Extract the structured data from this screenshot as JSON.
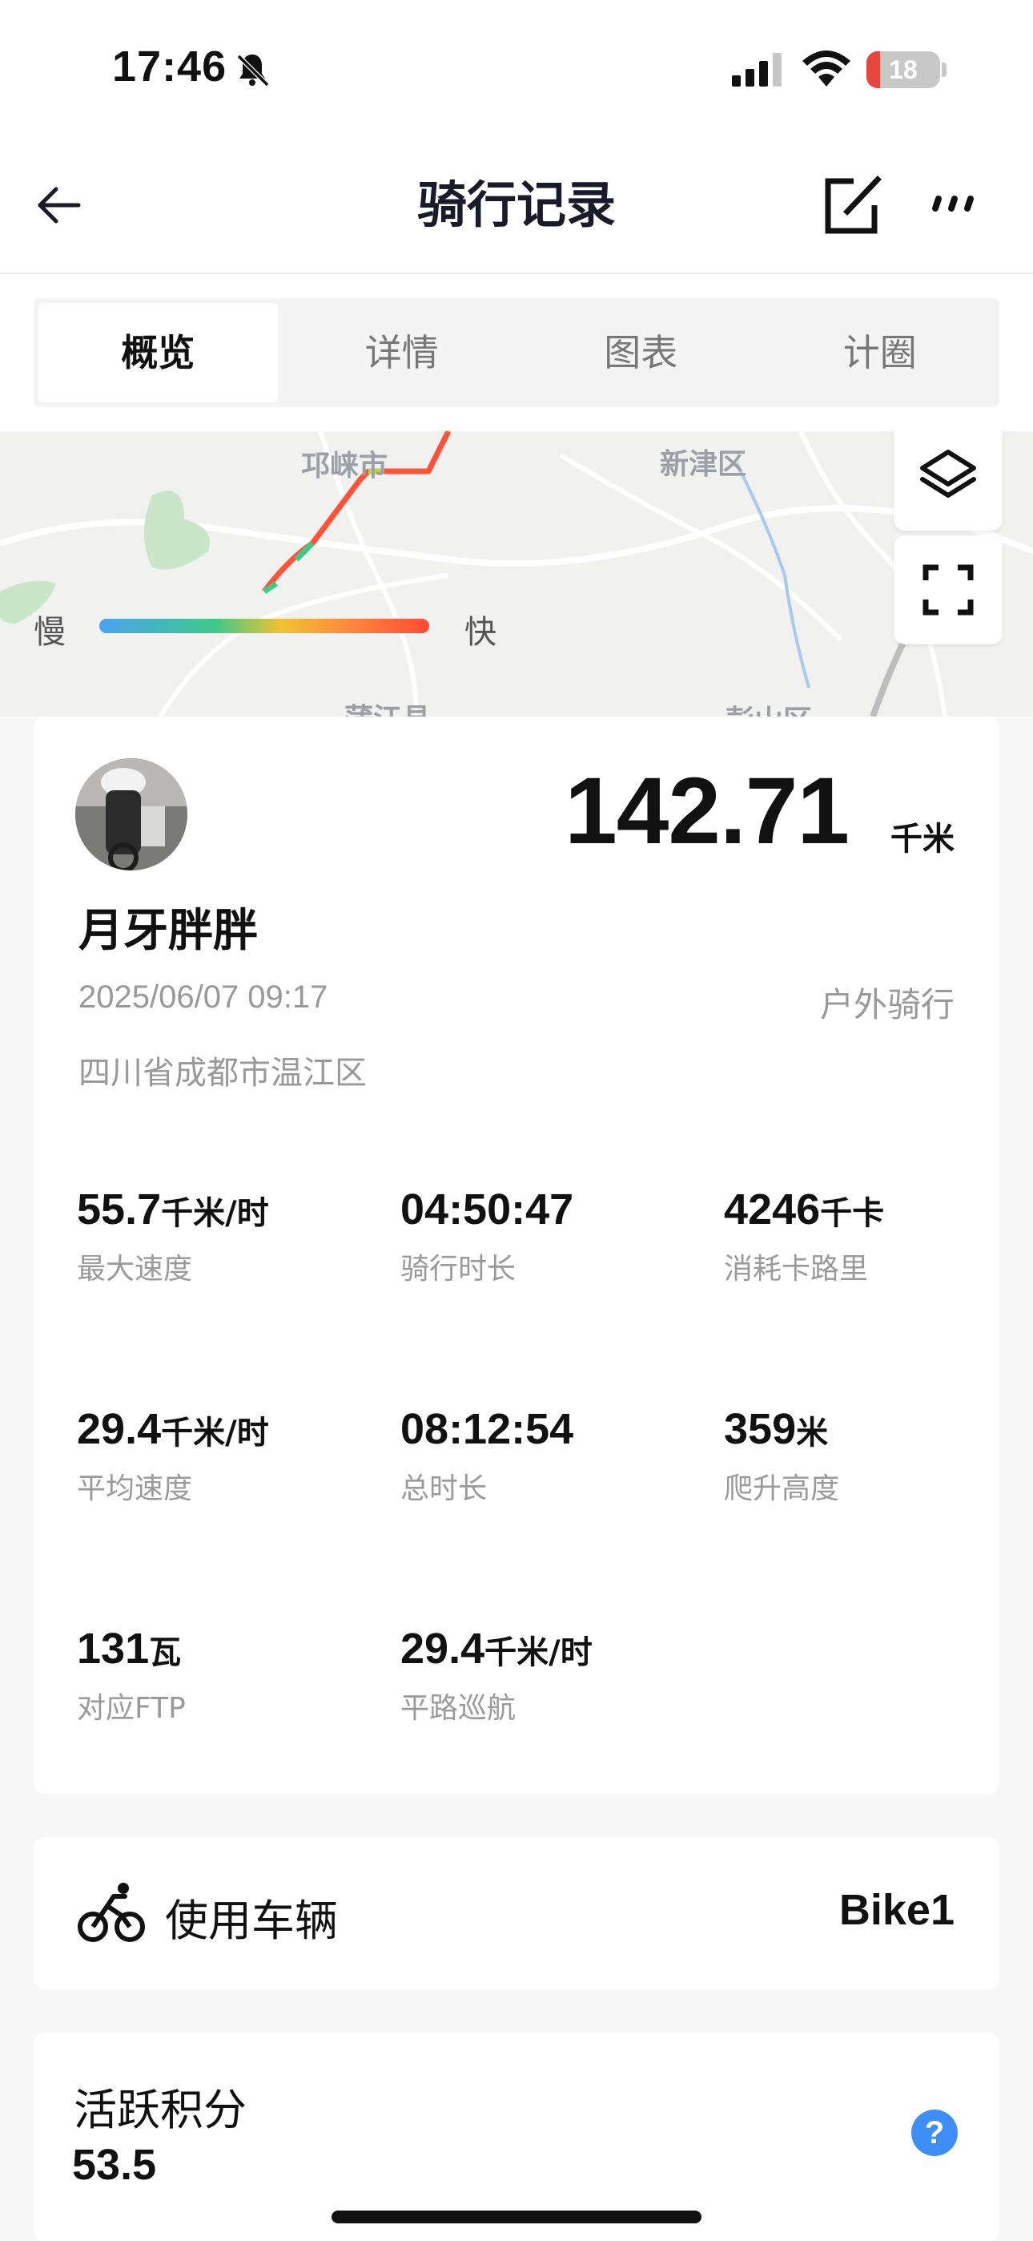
{
  "status_bar": {
    "time": "17:46",
    "battery_level": "18",
    "battery_fraction": 0.18
  },
  "nav": {
    "title": "骑行记录"
  },
  "tabs": [
    {
      "label": "概览",
      "active": true
    },
    {
      "label": "详情",
      "active": false
    },
    {
      "label": "图表",
      "active": false
    },
    {
      "label": "计圈",
      "active": false
    }
  ],
  "map": {
    "places": [
      "邛崃市",
      "新津区",
      "蒲江县",
      "彭山区"
    ],
    "legend_slow": "慢",
    "legend_fast": "快"
  },
  "summary": {
    "distance": "142.71",
    "distance_unit": "千米",
    "user_name": "月牙胖胖",
    "date": "2025/06/07 09:17",
    "ride_type": "户外骑行",
    "location": "四川省成都市温江区"
  },
  "stats": [
    {
      "value": "55.7",
      "unit": "千米/时",
      "label": "最大速度"
    },
    {
      "value": "04:50:47",
      "unit": "",
      "label": "骑行时长"
    },
    {
      "value": "4246",
      "unit": "千卡",
      "label": "消耗卡路里"
    },
    {
      "value": "29.4",
      "unit": "千米/时",
      "label": "平均速度"
    },
    {
      "value": "08:12:54",
      "unit": "",
      "label": "总时长"
    },
    {
      "value": "359",
      "unit": "米",
      "label": "爬升高度"
    },
    {
      "value": "131",
      "unit": "瓦",
      "label": "对应FTP"
    },
    {
      "value": "29.4",
      "unit": "千米/时",
      "label": "平路巡航"
    }
  ],
  "bike": {
    "label": "使用车辆",
    "value": "Bike1"
  },
  "points": {
    "title": "活跃积分",
    "value": "53.5",
    "help": "?"
  },
  "colors": {
    "accent": "#3e8ef7",
    "route": "#ff4a36",
    "battery_low": "#e5473d"
  },
  "icons": [
    "bell-slash-icon",
    "signal-icon",
    "wifi-icon",
    "back-arrow-icon",
    "edit-icon",
    "more-icon",
    "layers-icon",
    "fullscreen-icon",
    "bike-icon",
    "help-icon"
  ]
}
